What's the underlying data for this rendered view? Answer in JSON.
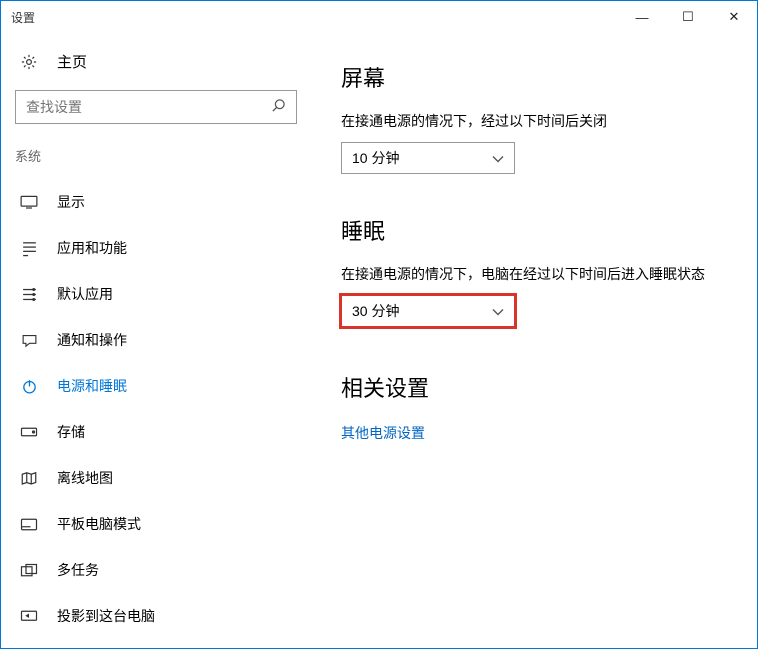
{
  "window": {
    "title": "设置",
    "min": "—",
    "max": "☐",
    "close": "✕"
  },
  "sidebar": {
    "home": "主页",
    "search_placeholder": "查找设置",
    "category": "系统",
    "items": [
      {
        "label": "显示"
      },
      {
        "label": "应用和功能"
      },
      {
        "label": "默认应用"
      },
      {
        "label": "通知和操作"
      },
      {
        "label": "电源和睡眠"
      },
      {
        "label": "存储"
      },
      {
        "label": "离线地图"
      },
      {
        "label": "平板电脑模式"
      },
      {
        "label": "多任务"
      },
      {
        "label": "投影到这台电脑"
      }
    ]
  },
  "main": {
    "screen": {
      "heading": "屏幕",
      "desc": "在接通电源的情况下，经过以下时间后关闭",
      "value": "10 分钟"
    },
    "sleep": {
      "heading": "睡眠",
      "desc": "在接通电源的情况下，电脑在经过以下时间后进入睡眠状态",
      "value": "30 分钟"
    },
    "related": {
      "heading": "相关设置",
      "link": "其他电源设置"
    }
  }
}
